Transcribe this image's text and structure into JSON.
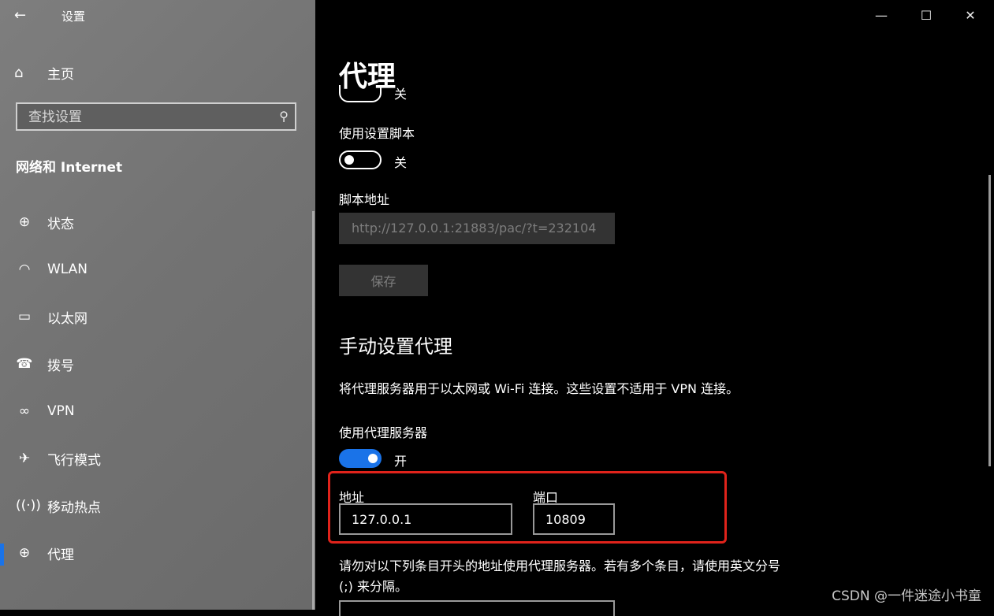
{
  "window": {
    "title": "设置",
    "controls": {
      "minimize": "—",
      "maximize": "☐",
      "close": "✕"
    }
  },
  "sidebar": {
    "home_label": "主页",
    "search_placeholder": "查找设置",
    "section_title": "网络和 Internet",
    "items": [
      {
        "label": "状态",
        "icon": "status-globe-icon"
      },
      {
        "label": "WLAN",
        "icon": "wifi-icon"
      },
      {
        "label": "以太网",
        "icon": "ethernet-icon"
      },
      {
        "label": "拨号",
        "icon": "dialup-icon"
      },
      {
        "label": "VPN",
        "icon": "vpn-icon"
      },
      {
        "label": "飞行模式",
        "icon": "airplane-icon"
      },
      {
        "label": "移动热点",
        "icon": "hotspot-icon"
      },
      {
        "label": "代理",
        "icon": "globe-icon",
        "active": true
      }
    ]
  },
  "main": {
    "title": "代理",
    "auto_detect_state": "关",
    "use_script_label": "使用设置脚本",
    "use_script_state": "关",
    "script_address_label": "脚本地址",
    "script_address_value": "http://127.0.0.1:21883/pac/?t=232104",
    "save_label": "保存",
    "manual_heading": "手动设置代理",
    "manual_desc": "将代理服务器用于以太网或 Wi-Fi 连接。这些设置不适用于 VPN 连接。",
    "use_proxy_label": "使用代理服务器",
    "use_proxy_state": "开",
    "address_label": "地址",
    "address_value": "127.0.0.1",
    "port_label": "端口",
    "port_value": "10809",
    "exceptions_text": "请勿对以下列条目开头的地址使用代理服务器。若有多个条目，请使用英文分号 (;) 来分隔。"
  },
  "colors": {
    "accent": "#1a73e8",
    "highlight_box": "#e0231b"
  },
  "watermark": "CSDN @一件迷途小书童"
}
